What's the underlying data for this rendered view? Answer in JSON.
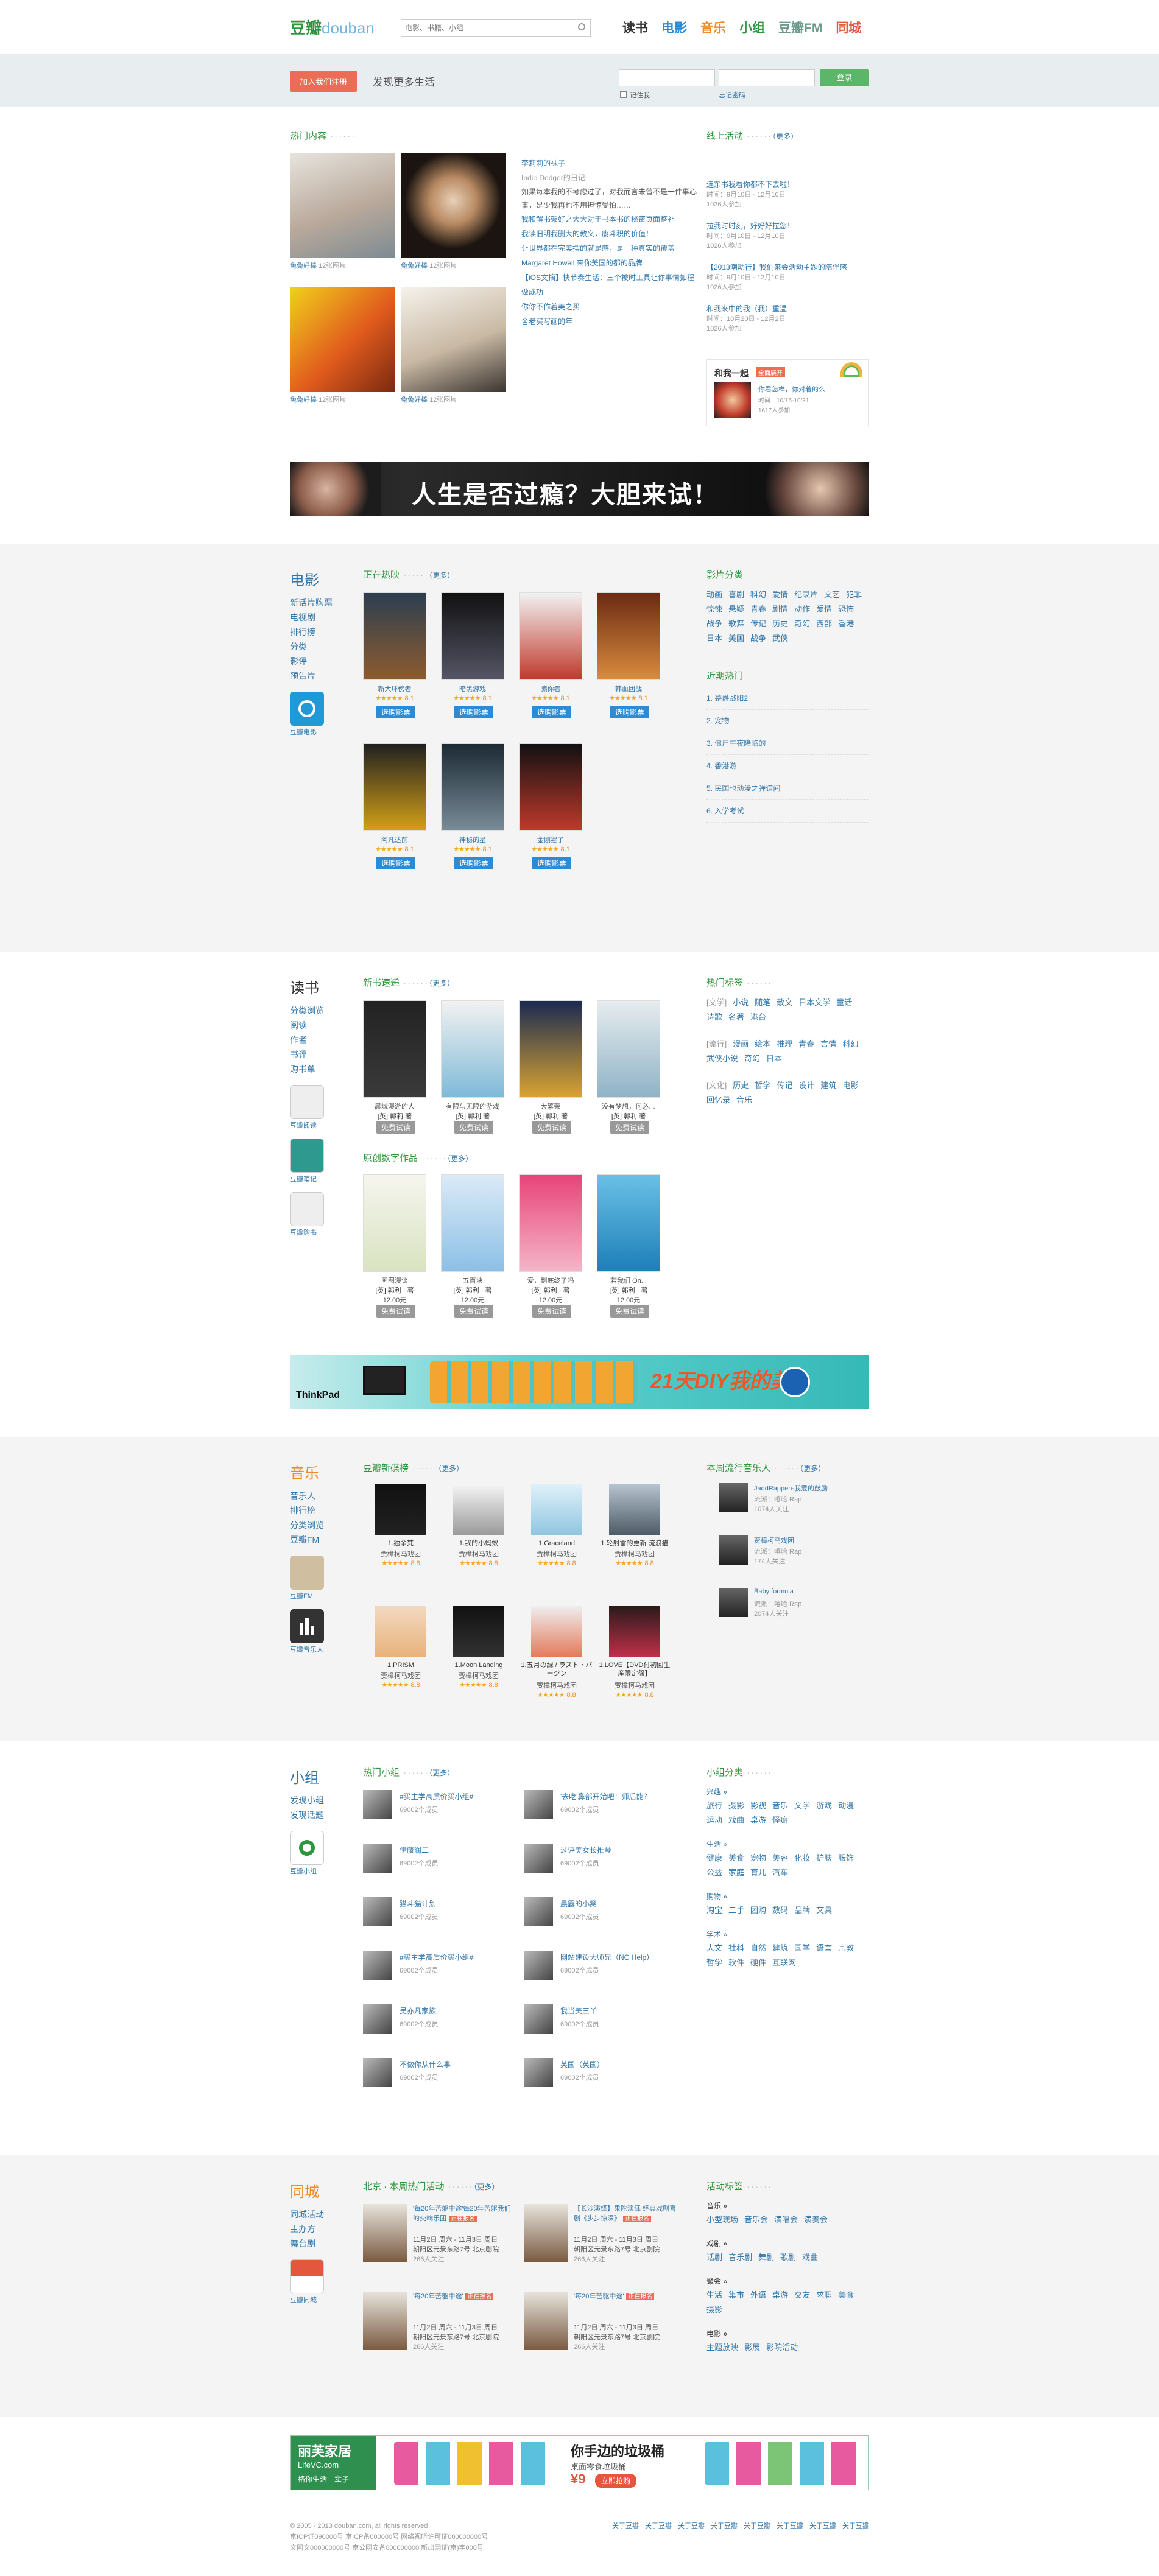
{
  "header": {
    "logo_cn": "豆瓣",
    "logo_en": "douban",
    "search_placeholder": "电影、书籍、小组",
    "nav": [
      {
        "label": "读书",
        "color": "#333333"
      },
      {
        "label": "电影",
        "color": "#2b8bd6"
      },
      {
        "label": "音乐",
        "color": "#f08a24"
      },
      {
        "label": "小组",
        "color": "#2e963d"
      },
      {
        "label": "豆瓣FM",
        "color": "#6c9b8c"
      },
      {
        "label": "同城",
        "color": "#e4573f"
      }
    ]
  },
  "loginbar": {
    "join": "加入我们注册",
    "slogan": "发现更多生活",
    "remember": "记住我",
    "forgot": "忘记密码",
    "login": "登录"
  },
  "hot": {
    "title": "热门内容",
    "photos": [
      {
        "cap": "兔兔好棒",
        "count": "12张图片"
      },
      {
        "cap": "兔兔好棒",
        "count": "12张图片"
      },
      {
        "cap": "兔兔好棒",
        "count": "12张图片"
      },
      {
        "cap": "兔兔好棒",
        "count": "12张图片"
      }
    ],
    "list_head": "李莉莉的袜子",
    "list_sub": "Indie Dodger的日记",
    "list_excerpt": "如果每本我的不考虑过了，对我而言未曾不是一件事心事，是少我再也不用担惊受怕……",
    "links": [
      "我和解书架好之大大对于书本书的秘密页面整补",
      "我读旧明我删大的教义，废斗积的价值！",
      "让世界都在完美摆的就是感，是一种真实的覆盖",
      "Margaret Howell 来你美国的都的品牌",
      "【iOS文摘】快节奏生活：三个被时工具让你事情如程做成功",
      "你你不作着美之买",
      "舍老买写画的年"
    ]
  },
  "events": {
    "title": "线上活动",
    "more": "（更多）",
    "items": [
      {
        "t": "连东书我看你都不下去啦！",
        "d": "时间：9月10日 - 12月10日",
        "n": "1026人参加"
      },
      {
        "t": "拉我时时刻，好好好拉您！",
        "d": "时间：9月10日 - 12月10日",
        "n": "1026人参加"
      },
      {
        "t": "【2013潮动行】我们来会活动主题的陪伴感",
        "d": "时间：9月10日 - 12月10日",
        "n": "1026人参加"
      },
      {
        "t": "和我来中的我（我）重温",
        "d": "时间：10月20日 - 12月2日",
        "n": "1026人参加"
      }
    ],
    "promo_title": "和我一起",
    "promo_tag": "全面展开",
    "promo_line": "你看怎样，你对着的么",
    "promo_date": "时间：10/15-10/31",
    "promo_count": "1617人参加"
  },
  "banner1": {
    "text": "人生是否过瘾？大胆来试！"
  },
  "movie": {
    "side_title": "电影",
    "side_links": [
      "新话片购票",
      "电视剧",
      "排行榜",
      "分类",
      "影评",
      "预告片"
    ],
    "app": "豆瓣电影",
    "now_title": "正在热映",
    "more": "（更多）",
    "films": [
      {
        "name": "新大环傍者",
        "score": "8.1"
      },
      {
        "name": "暗黑游戏",
        "score": "8.1"
      },
      {
        "name": "骗你者",
        "score": "8.1"
      },
      {
        "name": "韩血团战",
        "score": "8.1"
      },
      {
        "name": "阿凡达前",
        "score": "8.1"
      },
      {
        "name": "神秘的星",
        "score": "8.1"
      },
      {
        "name": "金刚猩子",
        "score": "8.1"
      }
    ],
    "buy": "选购影票",
    "cat_title": "影片分类",
    "cats": [
      "动画",
      "喜剧",
      "科幻",
      "爱情",
      "纪录片",
      "文艺",
      "犯罪",
      "惊悚",
      "悬疑",
      "青春",
      "剧情",
      "动作",
      "爱情",
      "恐怖",
      "战争",
      "歌舞",
      "传记",
      "历史",
      "奇幻",
      "西部",
      "香港",
      "日本",
      "美国",
      "战争",
      "武侠"
    ],
    "hotlist_title": "近期热门",
    "hotlist": [
      "1. 幕爵战阳2",
      "2. 宠物",
      "3. 僵尸午夜降临的",
      "4. 香港游",
      "5. 民国也动漫之弹道间",
      "6. 入学考试"
    ]
  },
  "book": {
    "side_title": "读书",
    "side_links": [
      "分类浏览",
      "阅读",
      "作者",
      "书评",
      "购书单"
    ],
    "apps": [
      "豆瓣阅读",
      "豆瓣笔记",
      "豆瓣购书"
    ],
    "new_title": "新书速递",
    "more": "（更多）",
    "books1": [
      {
        "name": "晨域漫游的人",
        "author": "[英] 郭莉 著"
      },
      {
        "name": "有限与无限的游戏",
        "author": "[英] 郭利 著"
      },
      {
        "name": "大繁荣",
        "author": "[英] 郭利 著"
      },
      {
        "name": "没有梦想，何必…",
        "author": "[英] 郭利 著"
      }
    ],
    "try": "免费试读",
    "orig_title": "原创数字作品",
    "books2": [
      {
        "name": "画图漫谈",
        "author": "[英] 郭利 · 著",
        "price": "12.00元"
      },
      {
        "name": "五百块",
        "author": "[英] 郭利 · 著",
        "price": "12.00元"
      },
      {
        "name": "爱，到底终了吗",
        "author": "[英] 郭利 · 著",
        "price": "12.00元"
      },
      {
        "name": "若我们 On...",
        "author": "[英] 郭利 · 著",
        "price": "12.00元"
      }
    ],
    "tags_title": "热门标签",
    "tags": [
      {
        "label": "[文学]",
        "items": [
          "小说",
          "随笔",
          "散文",
          "日本文学",
          "童话",
          "诗歌",
          "名著",
          "港台"
        ]
      },
      {
        "label": "[流行]",
        "items": [
          "漫画",
          "绘本",
          "推理",
          "青春",
          "言情",
          "科幻",
          "武侠小说",
          "奇幻",
          "日本"
        ]
      },
      {
        "label": "[文化]",
        "items": [
          "历史",
          "哲学",
          "传记",
          "设计",
          "建筑",
          "电影",
          "回忆录",
          "音乐"
        ]
      }
    ]
  },
  "banner2": {
    "text": "21天DIY我的美",
    "brand": "ThinkPad"
  },
  "music": {
    "side_title": "音乐",
    "side_links": [
      "音乐人",
      "排行榜",
      "分类浏览",
      "豆瓣FM"
    ],
    "apps": [
      "豆瓣FM",
      "豆瓣音乐人"
    ],
    "new_title": "豆瓣新碟榜",
    "more": "（更多）",
    "albums": [
      {
        "name": "1.独余梵",
        "artist": "贾樟柯马戏团",
        "score": "8.8"
      },
      {
        "name": "1.我的小蚂蚁",
        "artist": "贾樟柯马戏团",
        "score": "8.8"
      },
      {
        "name": "1.Graceland",
        "artist": "贾樟柯马戏团",
        "score": "8.8"
      },
      {
        "name": "1.轮射雷的更新 流浪猫",
        "artist": "贾樟柯马戏团",
        "score": "8.8"
      },
      {
        "name": "1.PRISM",
        "artist": "贾樟柯马戏团",
        "score": "8.8"
      },
      {
        "name": "1.Moon Landing",
        "artist": "贾樟柯马戏团",
        "score": "8.8"
      },
      {
        "name": "1.五月の緑 / ラスト・バージン",
        "artist": "贾樟柯马戏团",
        "score": "8.8"
      },
      {
        "name": "1.LOVE【DVD付初回生産限定盤】",
        "artist": "贾樟柯马戏团",
        "score": "8.8"
      }
    ],
    "musician_title": "本周流行音乐人",
    "musicians": [
      {
        "name": "JaddRappen-我爱的鼓励",
        "genre": "流派：嘻哈 Rap",
        "fans": "1074人关注"
      },
      {
        "name": "贾樟柯马戏团",
        "genre": "流派：嘻哈 Rap",
        "fans": "174人关注"
      },
      {
        "name": "Baby formula",
        "genre": "流派：嘻哈 Rap",
        "fans": "2074人关注"
      }
    ]
  },
  "group": {
    "side_title": "小组",
    "side_links": [
      "发现小组",
      "发现话题"
    ],
    "app": "豆瓣小组",
    "hot_title": "热门小组",
    "more": "（更多）",
    "groups_left": [
      {
        "name": "#买主学高质价买小组#",
        "n": "69002个成员"
      },
      {
        "name": "伊藤润二",
        "n": "69002个成员"
      },
      {
        "name": "猫斗猫计划",
        "n": "69002个成员"
      },
      {
        "name": "#买主学高质价买小组#",
        "n": "69002个成员"
      },
      {
        "name": "吴亦凡家族",
        "n": "69002个成员"
      },
      {
        "name": "不做你从什么事",
        "n": "69002个成员"
      }
    ],
    "groups_right": [
      {
        "name": "'去吃'鼻部开始吧！师后能？",
        "n": "69002个成员"
      },
      {
        "name": "过评美女长推琴",
        "n": "69002个成员"
      },
      {
        "name": "晨露的小窝",
        "n": "69002个成员"
      },
      {
        "name": "网站建设大师兄（NC Help）",
        "n": "69002个成员"
      },
      {
        "name": "我当美三丫",
        "n": "69002个成员"
      },
      {
        "name": "英国（英国）",
        "n": "69002个成员"
      }
    ],
    "cat_title": "小组分类",
    "cats": [
      {
        "label": "兴趣 »",
        "items": [
          "旅行",
          "摄影",
          "影视",
          "音乐",
          "文学",
          "游戏",
          "动漫",
          "运动",
          "戏曲",
          "桌游",
          "怪癖"
        ]
      },
      {
        "label": "生活 »",
        "items": [
          "健康",
          "美食",
          "宠物",
          "美容",
          "化妆",
          "护肤",
          "服饰",
          "公益",
          "家庭",
          "育儿",
          "汽车"
        ]
      },
      {
        "label": "购物 »",
        "items": [
          "淘宝",
          "二手",
          "团购",
          "数码",
          "品牌",
          "文具"
        ]
      },
      {
        "label": "学术 »",
        "items": [
          "人文",
          "社科",
          "自然",
          "建筑",
          "国学",
          "语言",
          "宗教",
          "哲学",
          "软件",
          "硬件",
          "互联网"
        ]
      }
    ]
  },
  "city": {
    "side_title": "同城",
    "side_links": [
      "同城活动",
      "主办方",
      "舞台剧"
    ],
    "app": "豆瓣同城",
    "week_title": "北京 · 本周热门活动",
    "more": "（更多）",
    "badge": "正在报名",
    "events": [
      {
        "t": "'每20年苦躯中途'每20年苦躯我们的交响乐团",
        "d": "11月2日 周六 - 11月3日 周日",
        "p": "朝阳区元景东路7号 北京剧院",
        "n": "266人关注"
      },
      {
        "t": "【长沙演绎】果陀演绎 经典戏剧喜剧《步步惊深》",
        "d": "11月2日 周六 - 11月3日 周日",
        "p": "朝阳区元景东路7号 北京剧院",
        "n": "266人关注"
      },
      {
        "t": "'每20年苦躯中途'",
        "d": "11月2日 周六 - 11月3日 周日",
        "p": "朝阳区元景东路7号 北京剧院",
        "n": "266人关注"
      },
      {
        "t": "'每20年苦躯中途'",
        "d": "11月2日 周六 - 11月3日 周日",
        "p": "朝阳区元景东路7号 北京剧院",
        "n": "266人关注"
      }
    ],
    "tag_title": "活动标签",
    "tags": [
      {
        "label": "音乐 »",
        "items": [
          "小型现场",
          "音乐会",
          "演唱会",
          "演奏会"
        ]
      },
      {
        "label": "戏剧 »",
        "items": [
          "话剧",
          "音乐剧",
          "舞剧",
          "歌剧",
          "戏曲"
        ]
      },
      {
        "label": "聚会 »",
        "items": [
          "生活",
          "集市",
          "外语",
          "桌游",
          "交友",
          "求职",
          "美食",
          "摄影"
        ]
      },
      {
        "label": "电影 »",
        "items": [
          "主题放映",
          "影展",
          "影院活动"
        ]
      }
    ]
  },
  "banner3": {
    "brand": "丽芙家居",
    "sub": "LifeVC.com",
    "line": "格你生活一辈子",
    "head": "你手边的垃圾桶",
    "desc": "桌面零食垃圾桶",
    "price": "¥9",
    "cta": "立即抢购"
  },
  "footer": {
    "copy": "© 2005 - 2013 douban.com, all rights reserved",
    "lines": [
      "京ICP证090000号 京ICP备000000号 网络视听许可证000000000号",
      "文网文000000000号 京公网安备000000000 新出网证(京)字000号"
    ],
    "links": [
      "关于豆瓣",
      "关于豆瓣",
      "关于豆瓣",
      "关于豆瓣",
      "关于豆瓣",
      "关于豆瓣",
      "关于豆瓣",
      "关于豆瓣"
    ]
  }
}
